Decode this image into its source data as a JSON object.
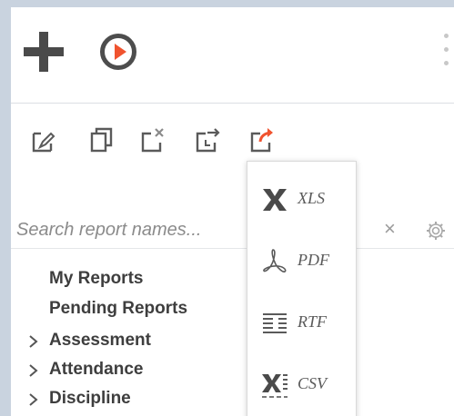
{
  "header": {
    "add_icon": "plus-icon",
    "run_icon": "play-circle-icon",
    "more_icon": "vertical-ellipsis-icon"
  },
  "toolbar": {
    "icons": [
      "edit-report-icon",
      "copy-report-icon",
      "delete-report-icon",
      "schedule-report-icon",
      "export-report-icon"
    ],
    "export_accent": "#f0532f"
  },
  "search": {
    "placeholder": "Search report names...",
    "clear_symbol": "×",
    "settings_icon": "gear-icon"
  },
  "tree": {
    "items": [
      {
        "label": "My Reports",
        "expandable": false
      },
      {
        "label": "Pending Reports",
        "expandable": false
      },
      {
        "label": "Assessment",
        "expandable": true
      },
      {
        "label": "Attendance",
        "expandable": true
      },
      {
        "label": "Discipline",
        "expandable": true
      }
    ]
  },
  "export_menu": {
    "items": [
      {
        "label": "XLS",
        "icon": "excel-icon"
      },
      {
        "label": "PDF",
        "icon": "pdf-icon"
      },
      {
        "label": "RTF",
        "icon": "rtf-icon"
      },
      {
        "label": "CSV",
        "icon": "csv-icon"
      }
    ]
  },
  "colors": {
    "page_background": "#c9d3df",
    "icon_gray": "#4a4a4a",
    "accent_orange": "#f0532f"
  }
}
